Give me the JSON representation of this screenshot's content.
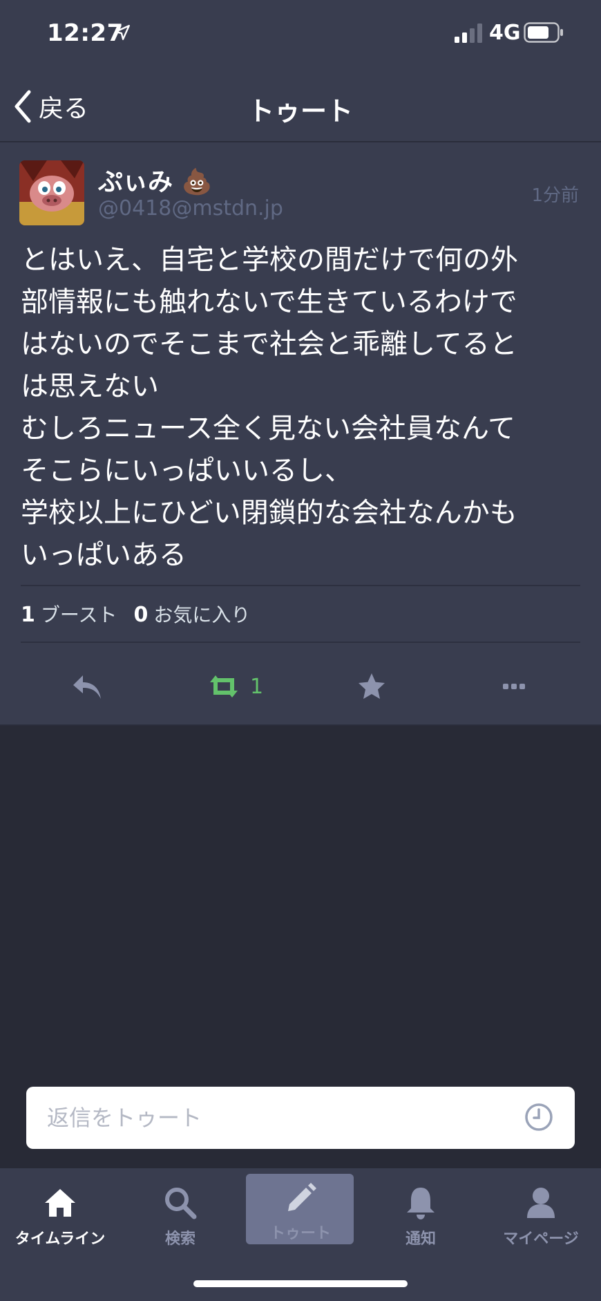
{
  "status_bar": {
    "time": "12:27",
    "network": "4G"
  },
  "nav": {
    "back_label": "戻る",
    "title": "トゥート"
  },
  "toot": {
    "display_name": "ぷぃみ 💩",
    "handle": "@0418@mstdn.jp",
    "timestamp": "1分前",
    "body": "とはいえ、自宅と学校の間だけで何の外\n部情報にも触れないで生きているわけで\nはないのでそこまで社会と乖離してると\nは思えない\nむしろニュース全く見ない会社員なんて\nそこらにいっぱいいるし、\n学校以上にひどい閉鎖的な会社なんかも\nいっぱいある",
    "boost_count": "1",
    "boost_label": "ブースト",
    "fav_count": "0",
    "fav_label": "お気に入り",
    "action_boost_count": "1"
  },
  "reply": {
    "placeholder": "返信をトゥート"
  },
  "tabs": [
    {
      "label": "タイムライン",
      "icon": "home-icon"
    },
    {
      "label": "検索",
      "icon": "search-icon"
    },
    {
      "label": "トゥート",
      "icon": "pencil-icon"
    },
    {
      "label": "通知",
      "icon": "bell-icon"
    },
    {
      "label": "マイページ",
      "icon": "user-icon"
    }
  ],
  "colors": {
    "background": "#282a36",
    "panel": "#393d4f",
    "muted": "#606984",
    "boost_green": "#63c26b",
    "tab_inactive": "#8d93ad"
  }
}
